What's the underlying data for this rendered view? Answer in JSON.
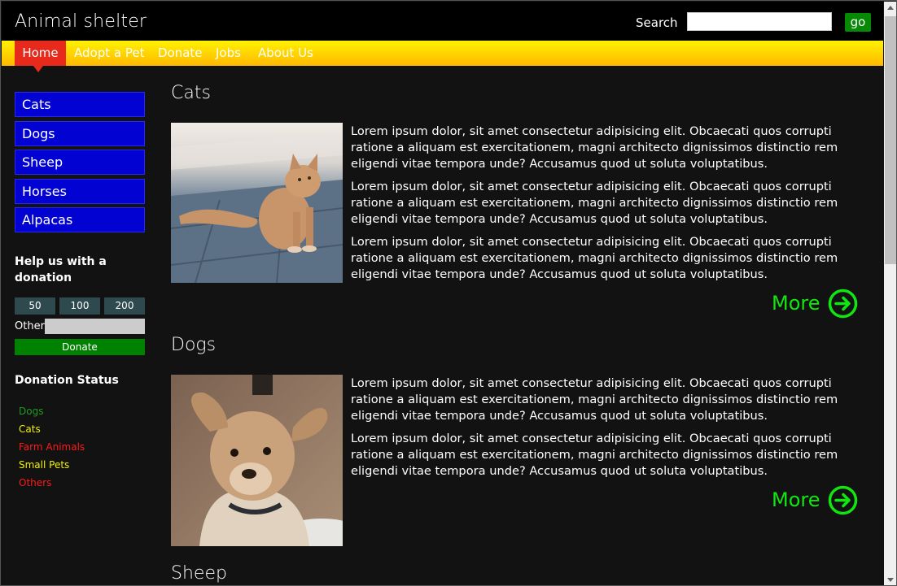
{
  "header": {
    "title": "Animal shelter",
    "search_label": "Search",
    "search_value": "",
    "go_label": "go"
  },
  "nav": {
    "items": [
      "Home",
      "Adopt a Pet",
      "Donate",
      "Jobs",
      "About Us"
    ],
    "active": "Home"
  },
  "sidebar": {
    "links": [
      "Cats",
      "Dogs",
      "Sheep",
      "Horses",
      "Alpacas"
    ],
    "donation_heading_line1": "Help us with a",
    "donation_heading_line2": "donation",
    "amounts": [
      "50",
      "100",
      "200"
    ],
    "other_label": "Other",
    "donate_label": "Donate",
    "status_heading": "Donation Status",
    "status_items": [
      {
        "label": "Dogs",
        "color": "#1f9a1f"
      },
      {
        "label": "Cats",
        "color": "#f0f000"
      },
      {
        "label": "Farm Animals",
        "color": "#ff1a1a"
      },
      {
        "label": "Small Pets",
        "color": "#f0f000"
      },
      {
        "label": "Others",
        "color": "#ff1a1a"
      }
    ]
  },
  "sections": [
    {
      "title": "Cats",
      "paragraphs": [
        "Lorem ipsum dolor, sit amet consectetur adipisicing elit. Obcaecati quos corrupti ratione a aliquam est exercitationem, magni architecto dignissimos distinctio rem eligendi vitae tempora unde? Accusamus quod ut soluta voluptatibus.",
        "Lorem ipsum dolor, sit amet consectetur adipisicing elit. Obcaecati quos corrupti ratione a aliquam est exercitationem, magni architecto dignissimos distinctio rem eligendi vitae tempora unde? Accusamus quod ut soluta voluptatibus.",
        "Lorem ipsum dolor, sit amet consectetur adipisicing elit. Obcaecati quos corrupti ratione a aliquam est exercitationem, magni architecto dignissimos distinctio rem eligendi vitae tempora unde? Accusamus quod ut soluta voluptatibus."
      ],
      "more_label": "More"
    },
    {
      "title": "Dogs",
      "paragraphs": [
        "Lorem ipsum dolor, sit amet consectetur adipisicing elit. Obcaecati quos corrupti ratione a aliquam est exercitationem, magni architecto dignissimos distinctio rem eligendi vitae tempora unde? Accusamus quod ut soluta voluptatibus.",
        "Lorem ipsum dolor, sit amet consectetur adipisicing elit. Obcaecati quos corrupti ratione a aliquam est exercitationem, magni architecto dignissimos distinctio rem eligendi vitae tempora unde? Accusamus quod ut soluta voluptatibus."
      ],
      "more_label": "More"
    },
    {
      "title": "Sheep"
    }
  ],
  "colors": {
    "accent_green": "#11e611",
    "nav_active": "#e82a1c",
    "sidebar_link_bg": "#0202d2"
  }
}
